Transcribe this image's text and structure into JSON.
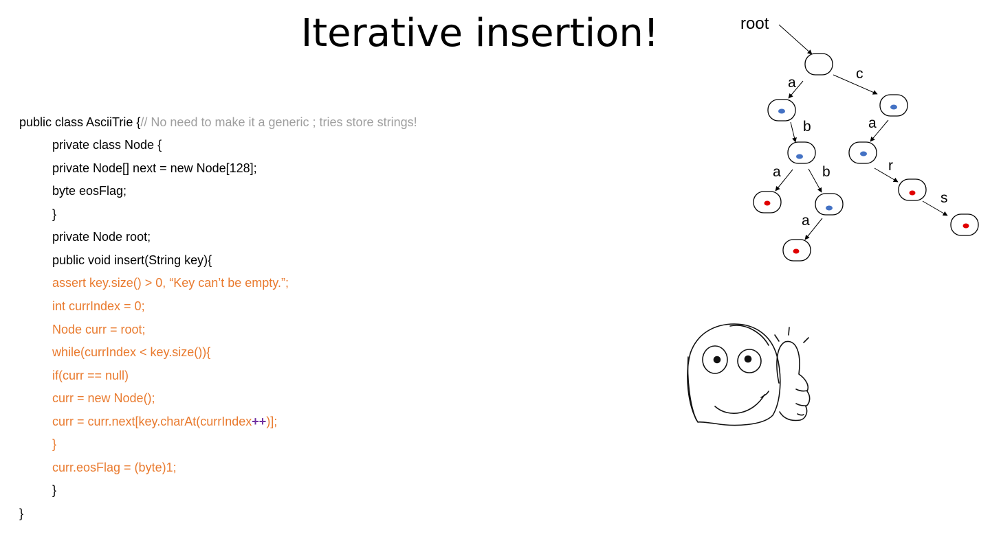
{
  "slide": {
    "title": "Iterative insertion!"
  },
  "code": {
    "l1_text": "public class AsciiTrie {",
    "l1_comment": "// No need to make it a generic ; tries store strings!",
    "l2": "private class Node {",
    "l3": "private Node[] next = new Node[128];",
    "l4": "byte eosFlag;",
    "l5": "}",
    "l6": "private Node root;",
    "l7": "public void insert(String key){",
    "l8": "assert key.size() > 0, “Key can’t be empty.”;",
    "l9": "int currIndex = 0;",
    "l10": "Node curr = root;",
    "l11": "while(currIndex < key.size()){",
    "l12": "if(curr == null)",
    "l13": "curr = new Node();",
    "l14_a": "curr = curr.next[key.charAt(currIndex",
    "l14_b": "++",
    "l14_c": ")];",
    "l15": "}",
    "l16": "curr.eosFlag = (byte)1;",
    "l17": "}",
    "l18": "}"
  },
  "trie": {
    "root_label": "root",
    "edges": {
      "a1": "a",
      "c": "c",
      "b1": "b",
      "a2": "a",
      "a3": "a",
      "b2": "b",
      "r": "r",
      "a4": "a",
      "s": "s"
    },
    "colors": {
      "intermediate": "#4472C4",
      "terminal": "#E00000"
    }
  },
  "decoration": {
    "icon": "thumbs-up-meme-face-icon"
  }
}
